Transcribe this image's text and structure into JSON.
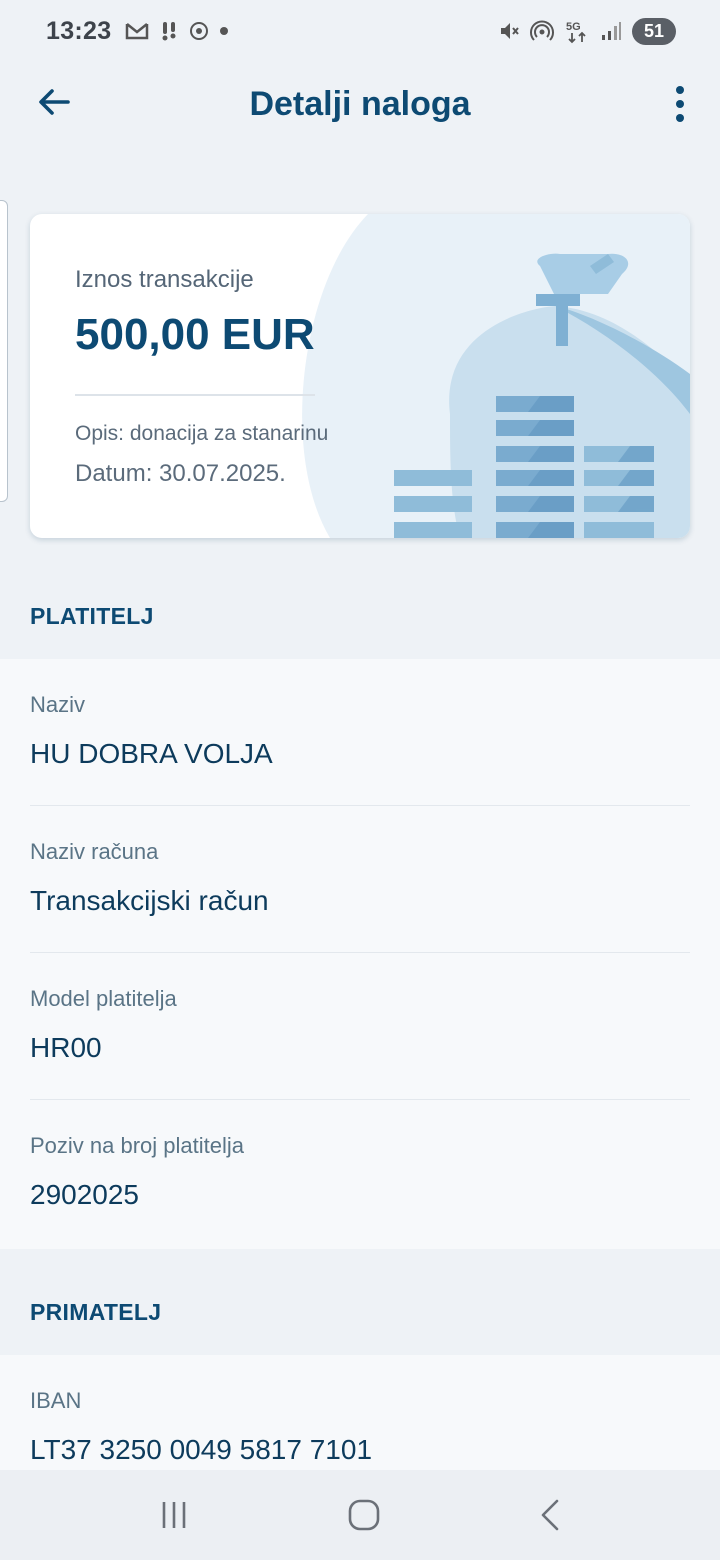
{
  "status_bar": {
    "time": "13:23",
    "battery": "51",
    "network": "5G",
    "left_icons": [
      "gmail-icon",
      "notification-icon",
      "soccer-icon",
      "dot-icon"
    ],
    "right_icons": [
      "mute-icon",
      "hotspot-icon",
      "5g-icon",
      "signal-icon",
      "battery-icon"
    ]
  },
  "appbar": {
    "title": "Detalji naloga"
  },
  "amount_card": {
    "label": "Iznos transakcije",
    "amount": "500,00 EUR",
    "description": "Opis: donacija za stanarinu",
    "date": "Datum: 30.07.2025."
  },
  "payer": {
    "header": "PLATITELJ",
    "fields": [
      {
        "label": "Naziv",
        "value": "HU DOBRA VOLJA"
      },
      {
        "label": "Naziv računa",
        "value": "Transakcijski račun"
      },
      {
        "label": "Model platitelja",
        "value": "HR00"
      },
      {
        "label": "Poziv na broj platitelja",
        "value": "2902025"
      }
    ]
  },
  "recipient": {
    "header": "PRIMATELJ",
    "fields": [
      {
        "label": "IBAN",
        "value": "LT37 3250 0049 5817 7101"
      }
    ]
  },
  "colors": {
    "brand": "#0d4a73",
    "background": "#eef2f6",
    "card": "#ffffff",
    "illustration": "#8fbcd9"
  }
}
